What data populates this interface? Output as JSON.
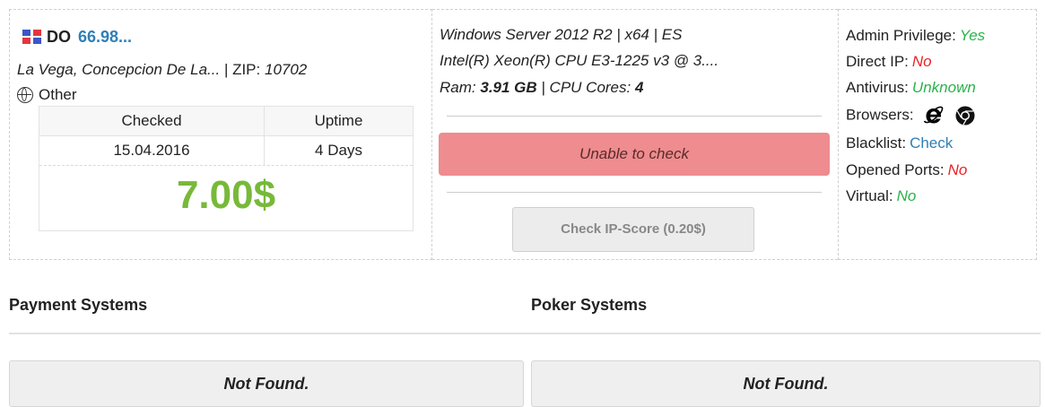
{
  "location": {
    "country_code": "DO",
    "ip": "66.98...",
    "city_line": "La Vega, Concepcion De La...",
    "zip_label": "| ZIP:",
    "zip": "10702",
    "isp": "Other"
  },
  "stats": {
    "headers": [
      "Checked",
      "Uptime"
    ],
    "values": [
      "15.04.2016",
      "4 Days"
    ],
    "price": "7.00$"
  },
  "system": {
    "os_line": "Windows Server 2012 R2 | x64 | ES",
    "cpu_line": "Intel(R) Xeon(R) CPU E3-1225 v3 @ 3....",
    "ram_label": "Ram:",
    "ram": "3.91 GB",
    "cores_label": "| CPU Cores:",
    "cores": "4",
    "status": "Unable to check",
    "ipscore_button": "Check IP-Score (0.20$)"
  },
  "props": {
    "admin_label": "Admin Privilege:",
    "admin": "Yes",
    "directip_label": "Direct IP:",
    "directip": "No",
    "antivirus_label": "Antivirus:",
    "antivirus": "Unknown",
    "browsers_label": "Browsers:",
    "browsers": [
      "internet-explorer-icon",
      "chrome-icon"
    ],
    "blacklist_label": "Blacklist:",
    "blacklist": "Check",
    "ports_label": "Opened Ports:",
    "ports": "No",
    "virtual_label": "Virtual:",
    "virtual": "No"
  },
  "sections": {
    "payment_title": "Payment Systems",
    "poker_title": "Poker Systems",
    "payment_result": "Not Found.",
    "poker_result": "Not Found."
  },
  "colors": {
    "price": "#77b93a",
    "status_bg": "#ee8c8f",
    "link": "#2f7fb7",
    "yes": "#2bb24c",
    "no": "#e8232a"
  }
}
